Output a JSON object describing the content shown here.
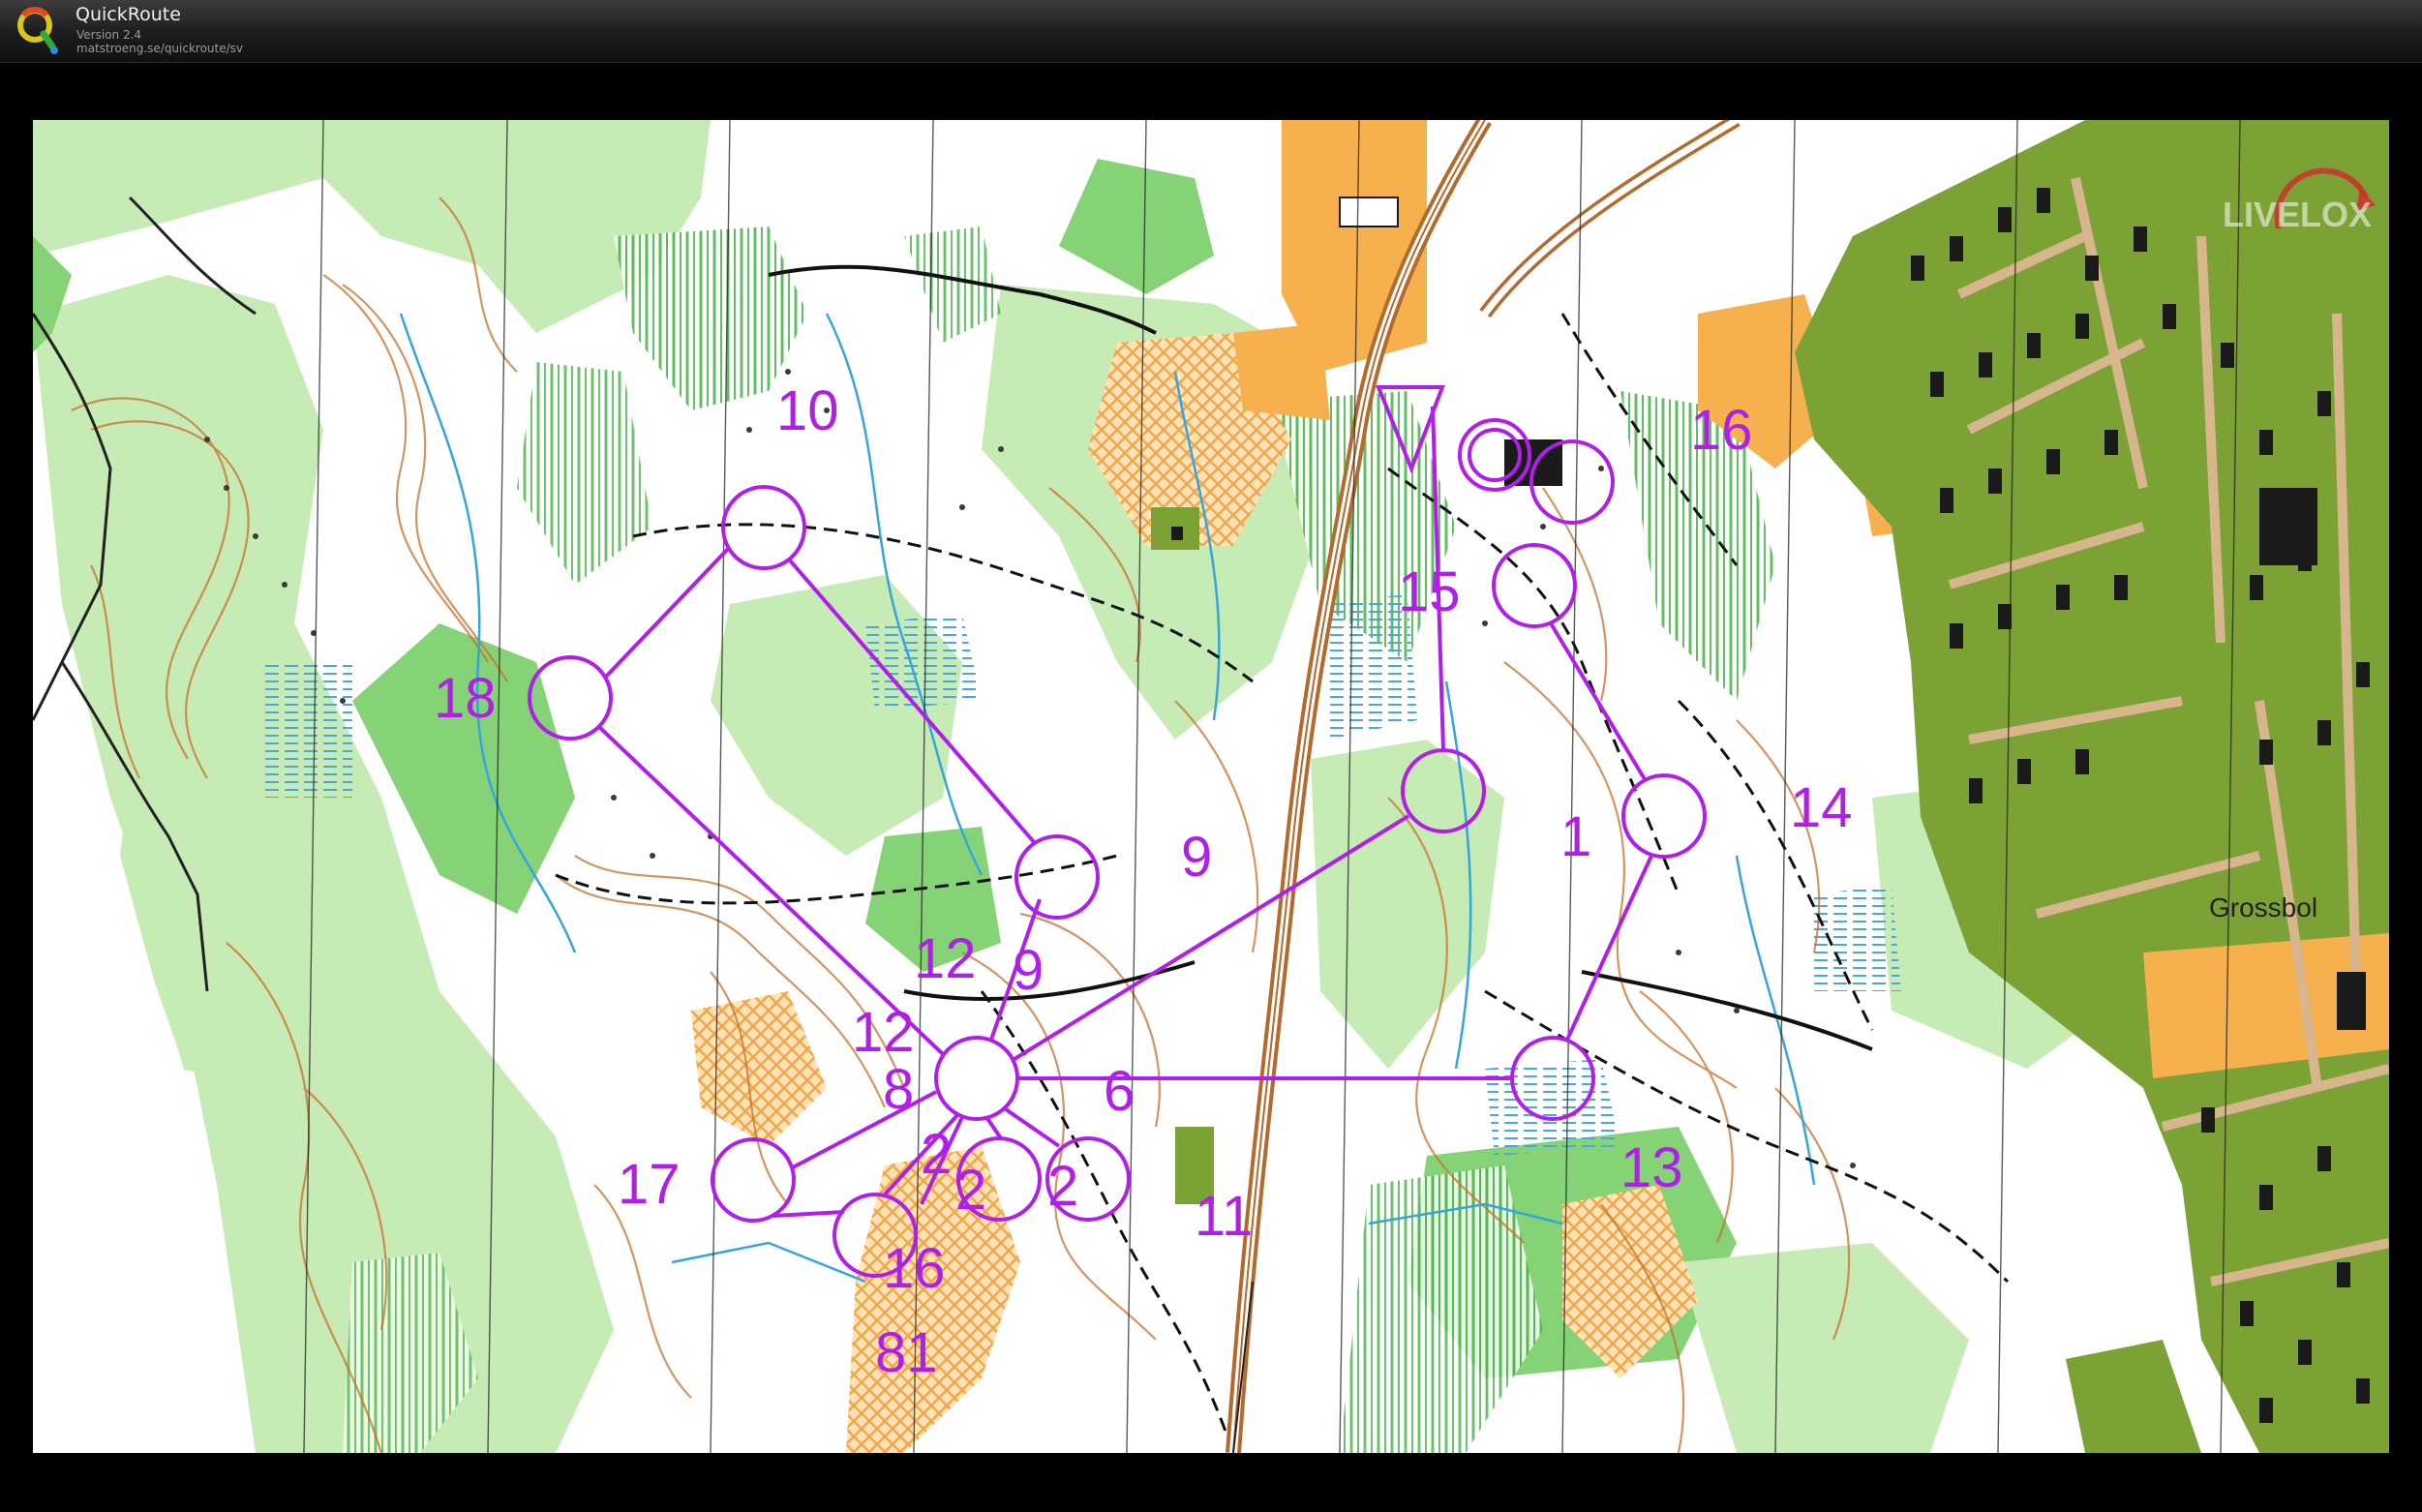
{
  "app": {
    "title": "QuickRoute",
    "version": "Version 2.4",
    "url": "matstroeng.se/quickroute/sv"
  },
  "map": {
    "place_label": "Grossbol",
    "watermark": "LIVELOX",
    "course_color": "#b01ee8",
    "terrain_colors": {
      "open": "#ffffff",
      "forest_light": "#c6ebb4",
      "forest_green": "#86d276",
      "field": "#f7b04e",
      "urban": "#7ca236",
      "building": "#1a1a1a"
    },
    "control_labels": [
      {
        "id": "10",
        "text": "10"
      },
      {
        "id": "18",
        "text": "18"
      },
      {
        "id": "16",
        "text": "16"
      },
      {
        "id": "15",
        "text": "15"
      },
      {
        "id": "1",
        "text": "1"
      },
      {
        "id": "14",
        "text": "14"
      },
      {
        "id": "9a",
        "text": "9"
      },
      {
        "id": "9b",
        "text": "9"
      },
      {
        "id": "12a",
        "text": "12"
      },
      {
        "id": "12b",
        "text": "12"
      },
      {
        "id": "8",
        "text": "8"
      },
      {
        "id": "6",
        "text": "6"
      },
      {
        "id": "13",
        "text": "13"
      },
      {
        "id": "17",
        "text": "17"
      },
      {
        "id": "2a",
        "text": "2"
      },
      {
        "id": "2b",
        "text": "2"
      },
      {
        "id": "2c",
        "text": "2"
      },
      {
        "id": "11",
        "text": "11"
      },
      {
        "id": "16b",
        "text": "16"
      },
      {
        "id": "81",
        "text": "81"
      }
    ]
  }
}
